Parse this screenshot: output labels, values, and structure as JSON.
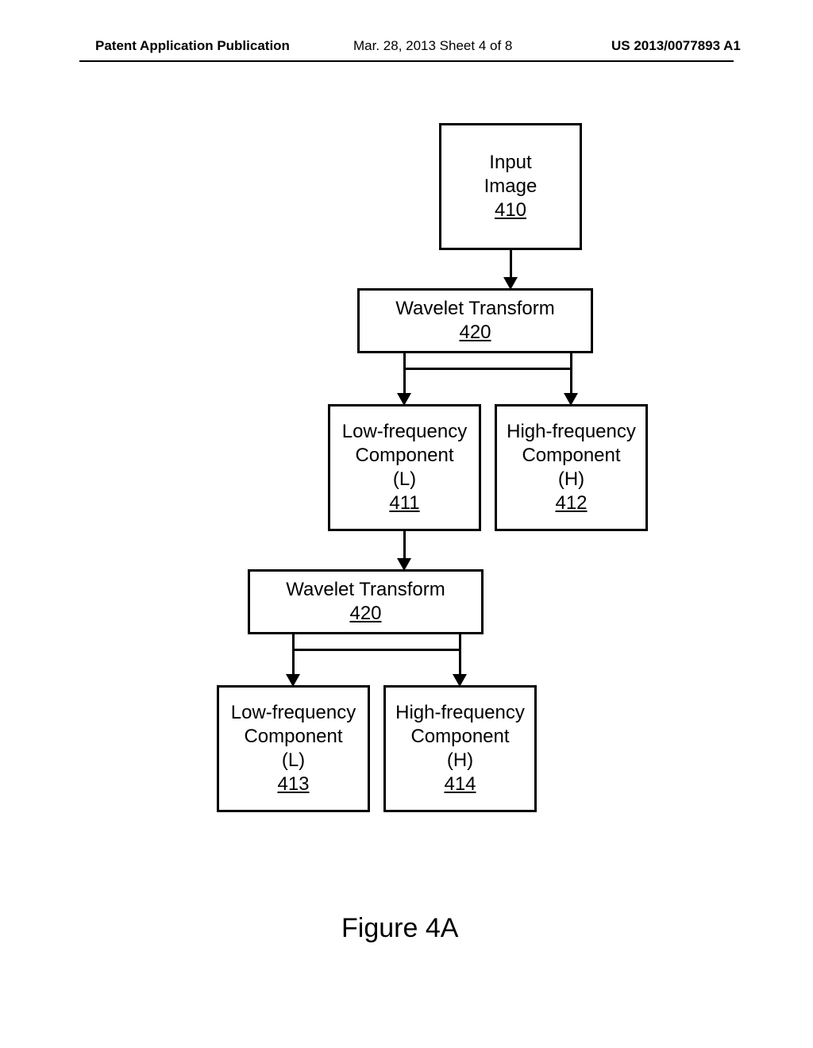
{
  "header": {
    "left": "Patent Application Publication",
    "mid": "Mar. 28, 2013  Sheet 4 of 8",
    "right": "US 2013/0077893 A1"
  },
  "boxes": {
    "input": {
      "l1": "Input",
      "l2": "Image",
      "ref": "410"
    },
    "wt1": {
      "l1": "Wavelet Transform",
      "ref": "420"
    },
    "low1": {
      "l1": "Low-frequency",
      "l2": "Component",
      "l3": "(L)",
      "ref": "411"
    },
    "high1": {
      "l1": "High-frequency",
      "l2": "Component",
      "l3": "(H)",
      "ref": "412"
    },
    "wt2": {
      "l1": "Wavelet Transform",
      "ref": "420"
    },
    "low2": {
      "l1": "Low-frequency",
      "l2": "Component",
      "l3": "(L)",
      "ref": "413"
    },
    "high2": {
      "l1": "High-frequency",
      "l2": "Component",
      "l3": "(H)",
      "ref": "414"
    }
  },
  "figure_label": "Figure 4A"
}
